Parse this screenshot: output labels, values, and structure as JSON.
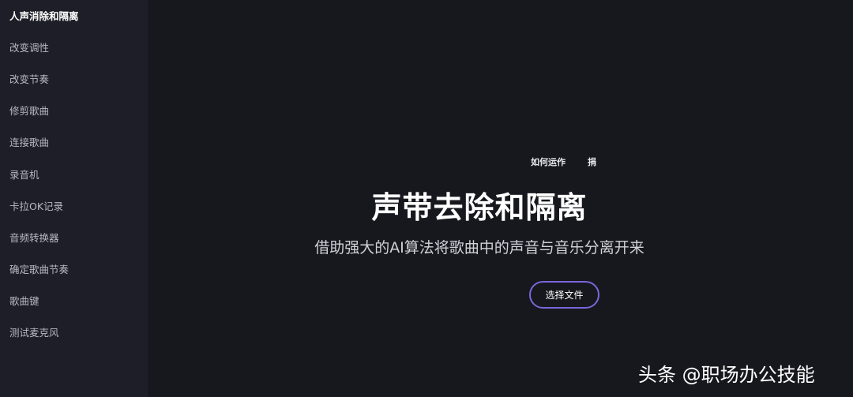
{
  "sidebar": {
    "items": [
      {
        "label": "人声消除和隔离",
        "active": true
      },
      {
        "label": "改变调性"
      },
      {
        "label": "改变节奏"
      },
      {
        "label": "修剪歌曲"
      },
      {
        "label": "连接歌曲"
      },
      {
        "label": "录音机"
      },
      {
        "label": "卡拉OK记录"
      },
      {
        "label": "音频转换器"
      },
      {
        "label": "确定歌曲节奏"
      },
      {
        "label": "歌曲键"
      },
      {
        "label": "测试麦克风"
      }
    ]
  },
  "main": {
    "links": [
      "如何运作",
      "捐"
    ],
    "title": "声带去除和隔离",
    "subtitle": "借助强大的AI算法将歌曲中的声音与音乐分离开来",
    "choose_file_label": "选择文件"
  },
  "watermark": "头条 @职场办公技能",
  "colors": {
    "background": "#17171e",
    "sidebar_background": "#1e1e28",
    "button_border": "#7a66d8"
  }
}
